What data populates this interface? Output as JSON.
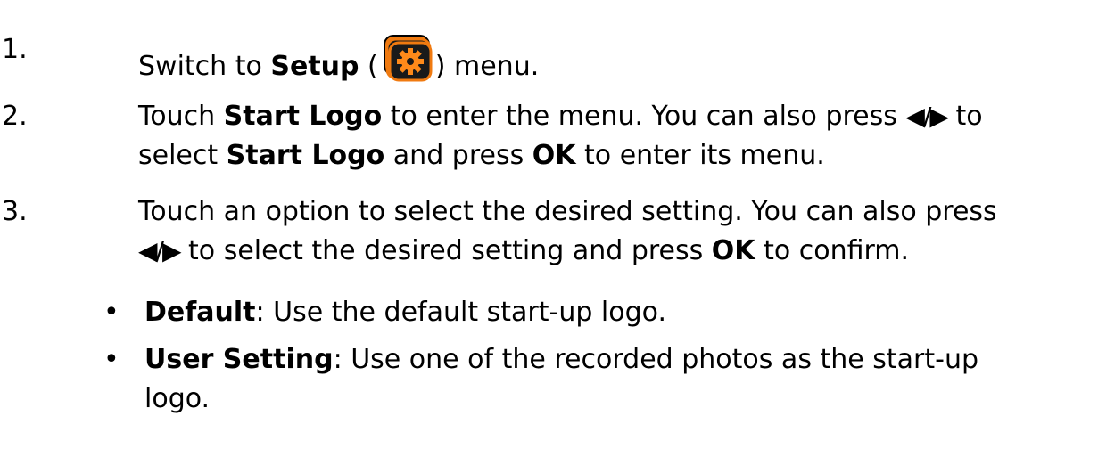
{
  "steps": [
    {
      "number": "1.",
      "before": "Switch to ",
      "bold": "Setup",
      "after_open": " (",
      "icon": "setup-menu-icon",
      "after_close": ") menu."
    },
    {
      "number": "2.",
      "l1_a": "Touch ",
      "l1_b": "Start Logo",
      "l1_c": " to enter the menu. You can also press ",
      "l1_arrows": "◀/▶",
      "l1_d": " to",
      "l2_a": "select ",
      "l2_b": "Start Logo",
      "l2_c": " and press ",
      "l2_d": "OK",
      "l2_e": " to enter its menu."
    },
    {
      "number": "3.",
      "l1": "Touch an option to select the desired setting. You can also press",
      "l2_arrows": "◀/▶",
      "l2_a": " to select the desired setting and press ",
      "l2_b": "OK",
      "l2_c": " to confirm."
    }
  ],
  "bullets": [
    {
      "term": "Default",
      "text": ": Use the default start-up logo."
    },
    {
      "term": "User Setting",
      "text": ": Use one of the recorded photos as the start-up",
      "text2": "logo."
    }
  ],
  "colors": {
    "icon_orange": "#f07a10",
    "icon_dark": "#1a1a1a",
    "gear": "#ff8a1a"
  }
}
